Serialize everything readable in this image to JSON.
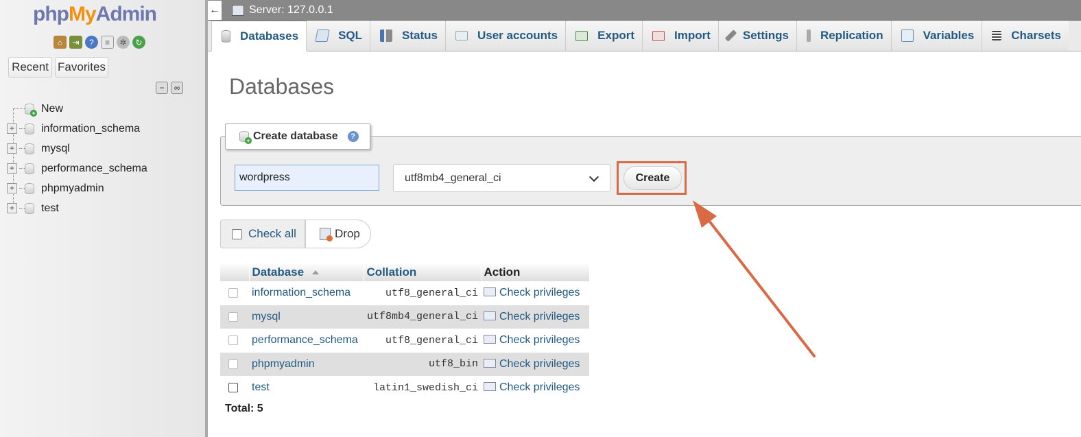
{
  "sidebar": {
    "logo": {
      "php": "php",
      "my": "My",
      "admin": "Admin"
    },
    "quick_icons": [
      "home-icon",
      "exit-icon",
      "help-icon",
      "docs-icon",
      "gear-icon",
      "reload-icon"
    ],
    "recent_label": "Recent",
    "favorites_label": "Favorites",
    "tree": [
      {
        "label": "New",
        "type": "new"
      },
      {
        "label": "information_schema",
        "type": "db"
      },
      {
        "label": "mysql",
        "type": "db"
      },
      {
        "label": "performance_schema",
        "type": "db"
      },
      {
        "label": "phpmyadmin",
        "type": "db"
      },
      {
        "label": "test",
        "type": "db"
      }
    ]
  },
  "topbar": {
    "back_label": "←",
    "server_label": "Server: 127.0.0.1"
  },
  "tabs": [
    {
      "label": "Databases",
      "icon": "database-icon",
      "active": true
    },
    {
      "label": "SQL",
      "icon": "sql-icon"
    },
    {
      "label": "Status",
      "icon": "status-icon"
    },
    {
      "label": "User accounts",
      "icon": "users-icon"
    },
    {
      "label": "Export",
      "icon": "export-icon"
    },
    {
      "label": "Import",
      "icon": "import-icon"
    },
    {
      "label": "Settings",
      "icon": "wrench-icon"
    },
    {
      "label": "Replication",
      "icon": "replication-icon"
    },
    {
      "label": "Variables",
      "icon": "variables-icon"
    },
    {
      "label": "Charsets",
      "icon": "charsets-icon"
    }
  ],
  "main": {
    "title": "Databases",
    "create": {
      "legend": "Create database",
      "name_value": "wordpress",
      "collation_value": "utf8mb4_general_ci",
      "button_label": "Create"
    },
    "bulk": {
      "check_all_label": "Check all",
      "drop_label": "Drop"
    },
    "table": {
      "headers": {
        "database": "Database",
        "collation": "Collation",
        "action": "Action"
      },
      "rows": [
        {
          "name": "information_schema",
          "collation": "utf8_general_ci",
          "action": "Check privileges"
        },
        {
          "name": "mysql",
          "collation": "utf8mb4_general_ci",
          "action": "Check privileges"
        },
        {
          "name": "performance_schema",
          "collation": "utf8_general_ci",
          "action": "Check privileges"
        },
        {
          "name": "phpmyadmin",
          "collation": "utf8_bin",
          "action": "Check privileges"
        },
        {
          "name": "test",
          "collation": "latin1_swedish_ci",
          "action": "Check privileges"
        }
      ]
    },
    "total": "Total: 5"
  },
  "colors": {
    "link": "#235a81",
    "annotation": "#d86a45",
    "logo_orange": "#f29111",
    "logo_blue": "#6c78af"
  }
}
